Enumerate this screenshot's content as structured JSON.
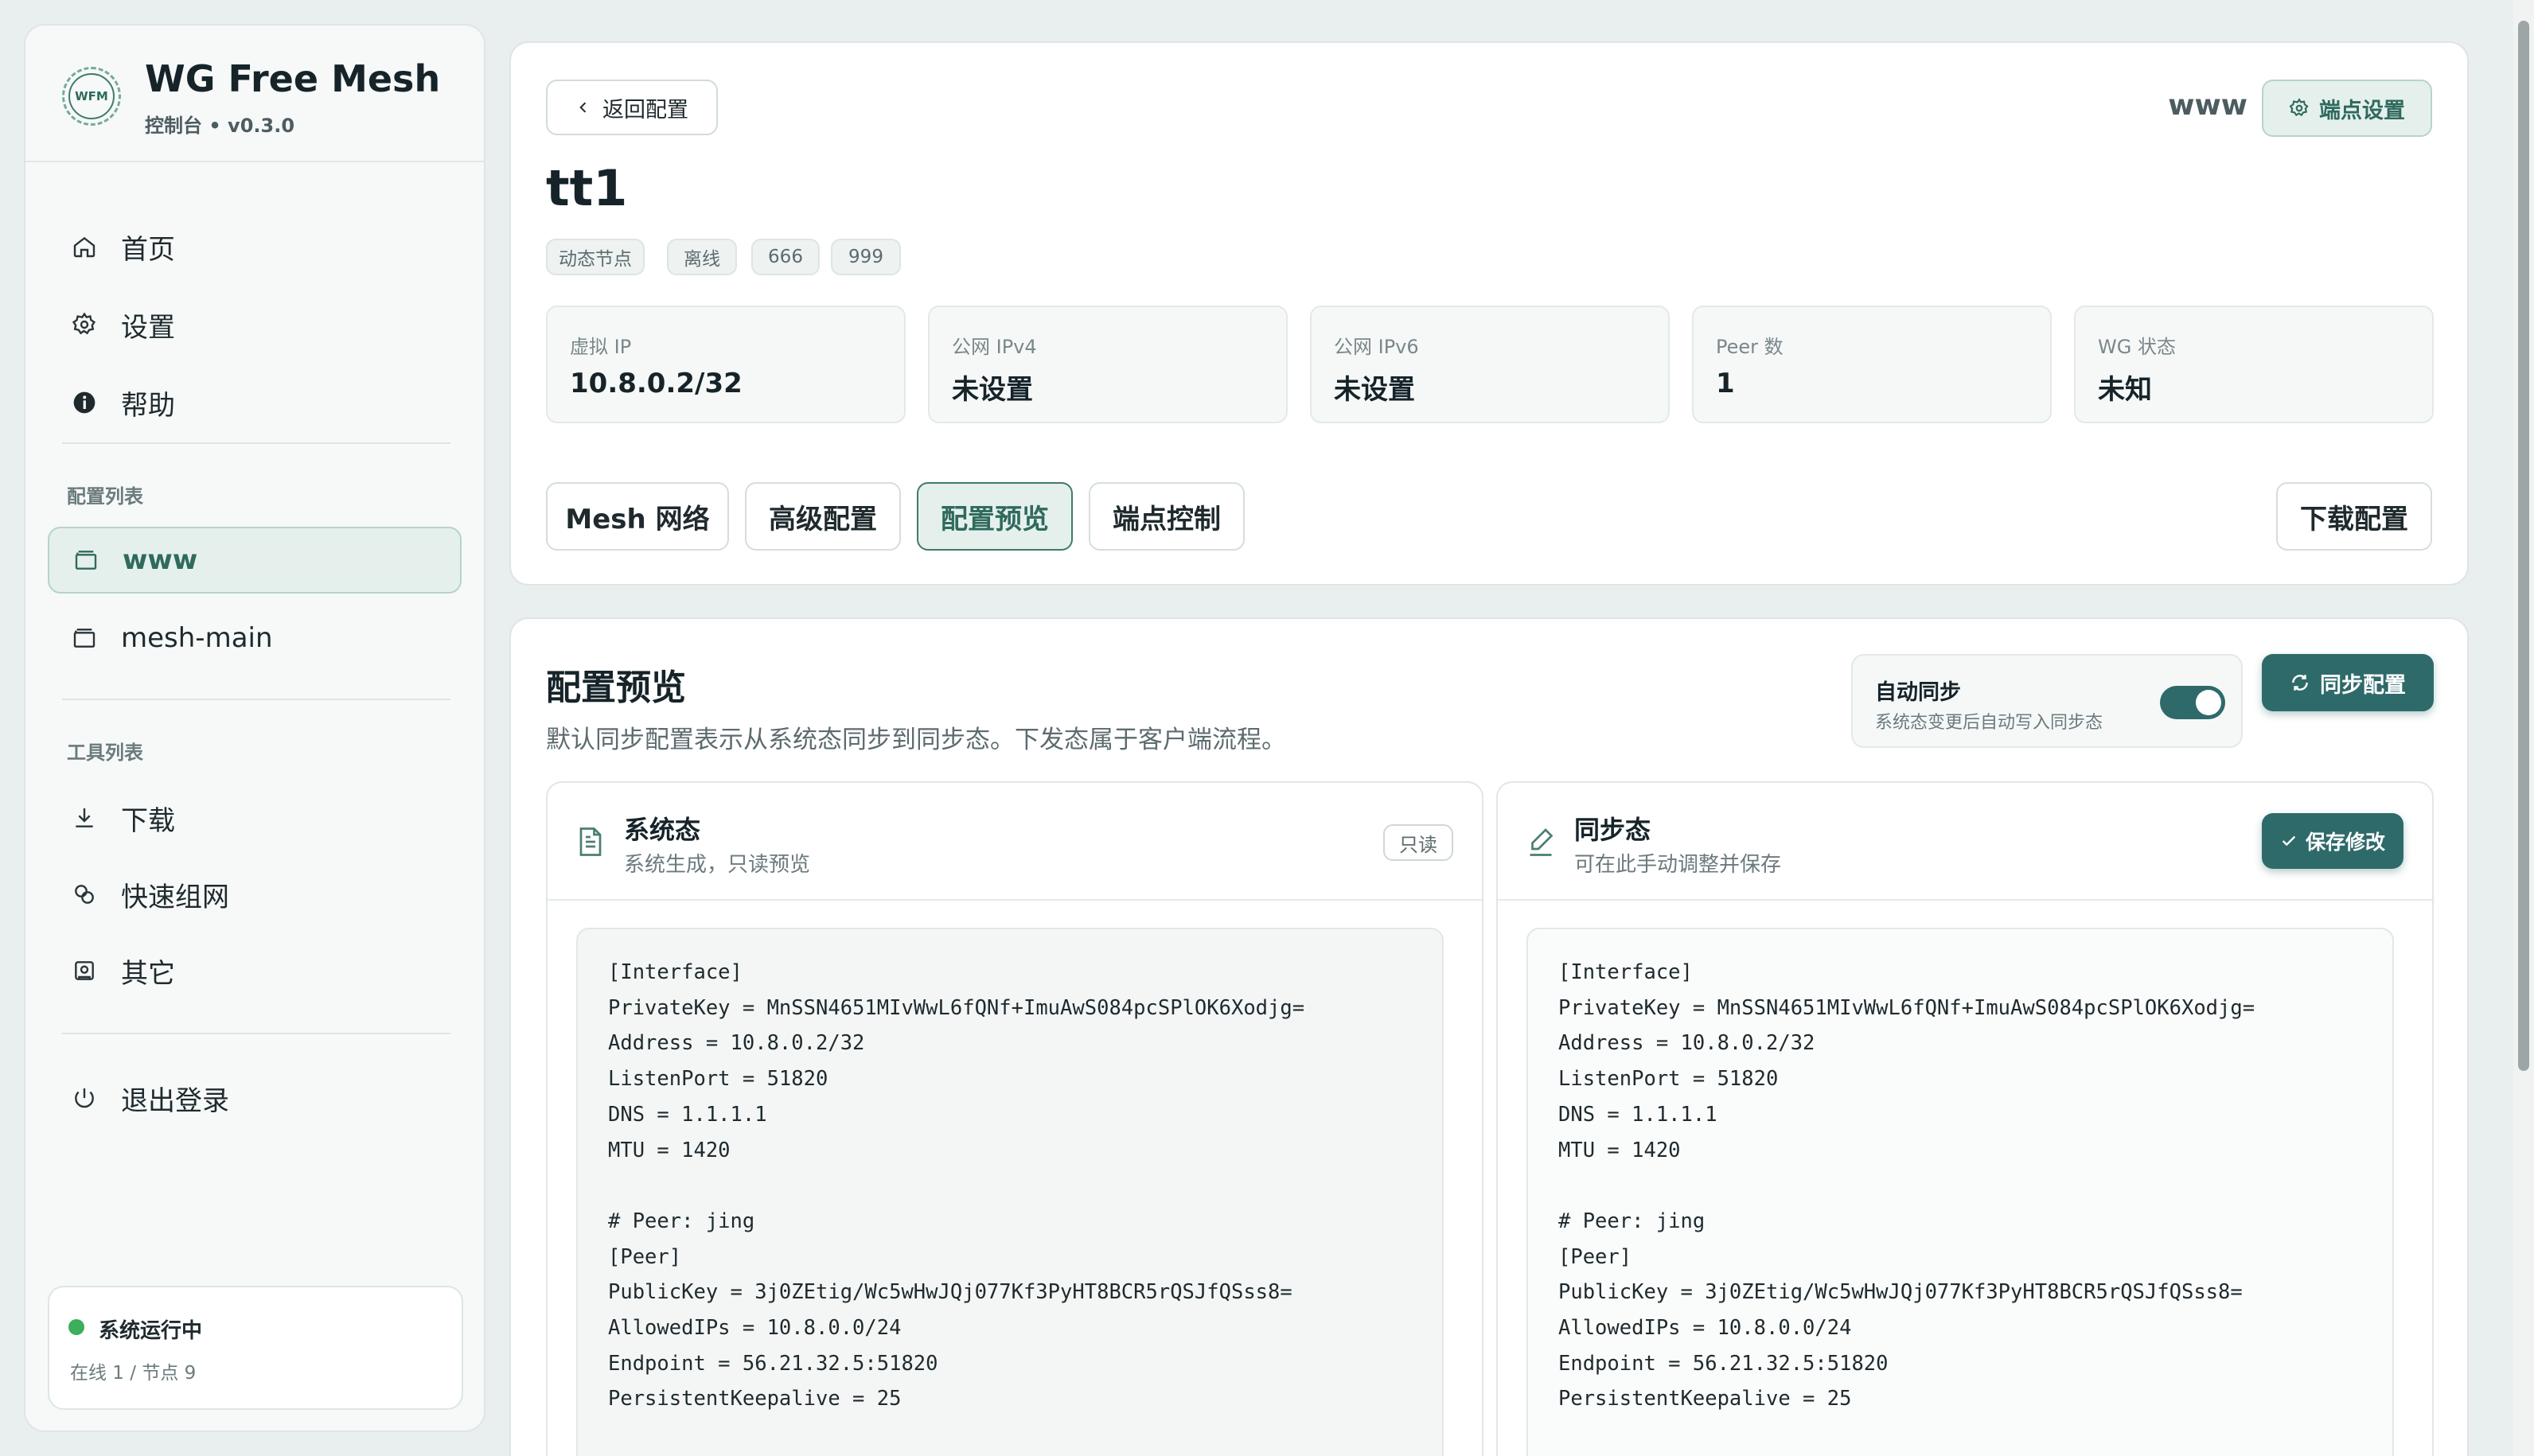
{
  "sidebar": {
    "brand": {
      "logo_text": "WFM",
      "title": "WG Free Mesh",
      "subtitle": "控制台 • v0.3.0"
    },
    "nav": [
      {
        "label": "首页",
        "icon": "home-icon"
      },
      {
        "label": "设置",
        "icon": "gear-icon"
      },
      {
        "label": "帮助",
        "icon": "info-icon"
      }
    ],
    "config_section_label": "配置列表",
    "configs": [
      {
        "label": "www",
        "icon": "folder-icon",
        "active": true
      },
      {
        "label": "mesh-main",
        "icon": "folder-icon",
        "active": false
      }
    ],
    "tools_section_label": "工具列表",
    "tools": [
      {
        "label": "下载",
        "icon": "download-icon"
      },
      {
        "label": "快速组网",
        "icon": "link-icon"
      },
      {
        "label": "其它",
        "icon": "box-icon"
      }
    ],
    "logout_label": "退出登录",
    "status": {
      "title": "系统运行中",
      "detail": "在线 1 / 节点 9",
      "color": "#3dae5a"
    }
  },
  "header": {
    "back_label": "返回配置",
    "config_name": "www",
    "node_settings_label": "端点设置",
    "node_name": "tt1",
    "tags": [
      "动态节点",
      "离线",
      "666",
      "999"
    ],
    "stats": [
      {
        "label": "虚拟 IP",
        "value": "10.8.0.2/32"
      },
      {
        "label": "公网 IPv4",
        "value": "未设置"
      },
      {
        "label": "公网 IPv6",
        "value": "未设置"
      },
      {
        "label": "Peer 数",
        "value": "1"
      },
      {
        "label": "WG 状态",
        "value": "未知"
      }
    ],
    "tabs": [
      {
        "label": "Mesh 网络",
        "active": false
      },
      {
        "label": "高级配置",
        "active": false
      },
      {
        "label": "配置预览",
        "active": true
      },
      {
        "label": "端点控制",
        "active": false
      }
    ],
    "download_label": "下载配置"
  },
  "preview": {
    "title": "配置预览",
    "description": "默认同步配置表示从系统态同步到同步态。下发态属于客户端流程。",
    "auto_sync": {
      "label": "自动同步",
      "hint": "系统态变更后自动写入同步态",
      "enabled": true
    },
    "sync_button_label": "同步配置",
    "system": {
      "title": "系统态",
      "subtitle": "系统生成，只读预览",
      "badge": "只读"
    },
    "synced": {
      "title": "同步态",
      "subtitle": "可在此手动调整并保存",
      "save_label": "保存修改"
    },
    "config_text": "[Interface]\nPrivateKey = MnSSN4651MIvWwL6fQNf+ImuAwS084pcSPlOK6Xodjg=\nAddress = 10.8.0.2/32\nListenPort = 51820\nDNS = 1.1.1.1\nMTU = 1420\n\n# Peer: jing\n[Peer]\nPublicKey = 3j0ZEtig/Wc5wHwJQj077Kf3PyHT8BCR5rQSJfQSss8=\nAllowedIPs = 10.8.0.0/24\nEndpoint = 56.21.32.5:51820\nPersistentKeepalive = 25"
  },
  "colors": {
    "accent": "#2f6a6a",
    "active_bg": "#e5f0ed",
    "online": "#3dae5a"
  }
}
